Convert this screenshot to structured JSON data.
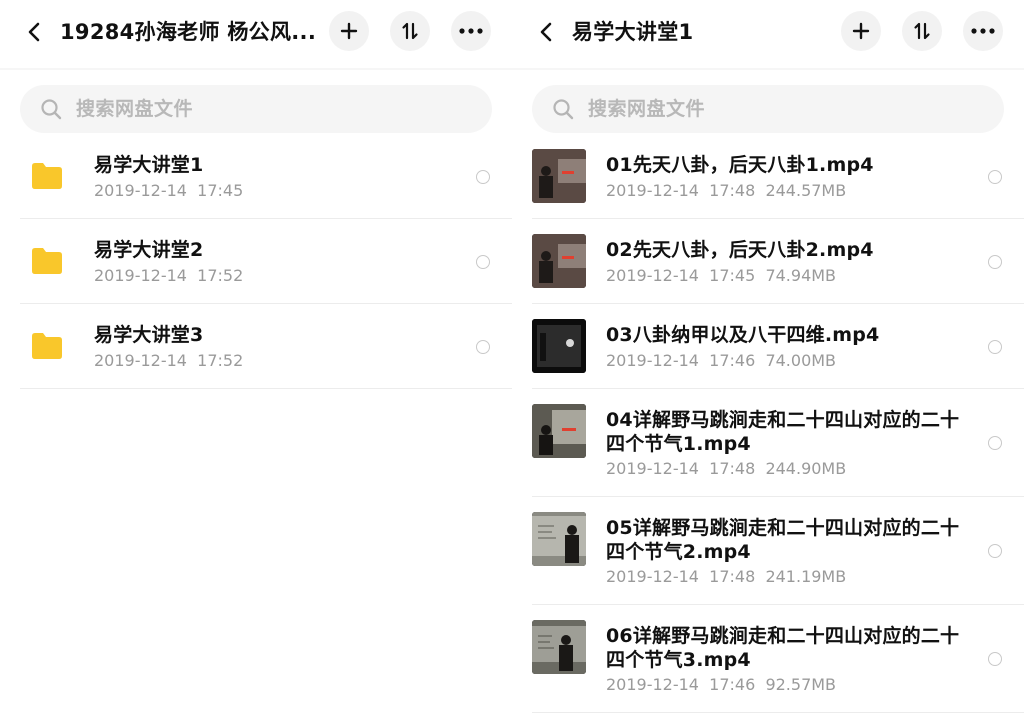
{
  "left": {
    "title": "19284孙海老师 杨公风...",
    "search_placeholder": "搜索网盘文件",
    "items": [
      {
        "name": "易学大讲堂1",
        "date": "2019-12-14  17:45"
      },
      {
        "name": "易学大讲堂2",
        "date": "2019-12-14  17:52"
      },
      {
        "name": "易学大讲堂3",
        "date": "2019-12-14  17:52"
      }
    ]
  },
  "right": {
    "title": "易学大讲堂1",
    "search_placeholder": "搜索网盘文件",
    "items": [
      {
        "name": "01先天八卦，后天八卦1.mp4",
        "meta": "2019-12-14  17:48  244.57MB"
      },
      {
        "name": "02先天八卦，后天八卦2.mp4",
        "meta": "2019-12-14  17:45  74.94MB"
      },
      {
        "name": "03八卦纳甲以及八干四维.mp4",
        "meta": "2019-12-14  17:46  74.00MB"
      },
      {
        "name_line1": "04详解野马跳涧走和二十四山对应的二十",
        "name_line2": "四个节气1.mp4",
        "meta": "2019-12-14  17:48  244.90MB"
      },
      {
        "name_line1": "05详解野马跳涧走和二十四山对应的二十",
        "name_line2": "四个节气2.mp4",
        "meta": "2019-12-14  17:48  241.19MB"
      },
      {
        "name_line1": "06详解野马跳涧走和二十四山对应的二十",
        "name_line2": "四个节气3.mp4",
        "meta": "2019-12-14  17:46  92.57MB"
      }
    ]
  },
  "icons": {
    "back": "chevron-left-icon",
    "add": "plus-icon",
    "sort": "sort-icon",
    "more": "more-icon",
    "search": "search-icon",
    "folder": "folder-icon",
    "check": "radio-circle-icon"
  },
  "colors": {
    "folder": "#f9c72b",
    "meta_text": "#9a9a9a",
    "button_bg": "#f2f2f2",
    "search_bg": "#f5f5f5"
  }
}
